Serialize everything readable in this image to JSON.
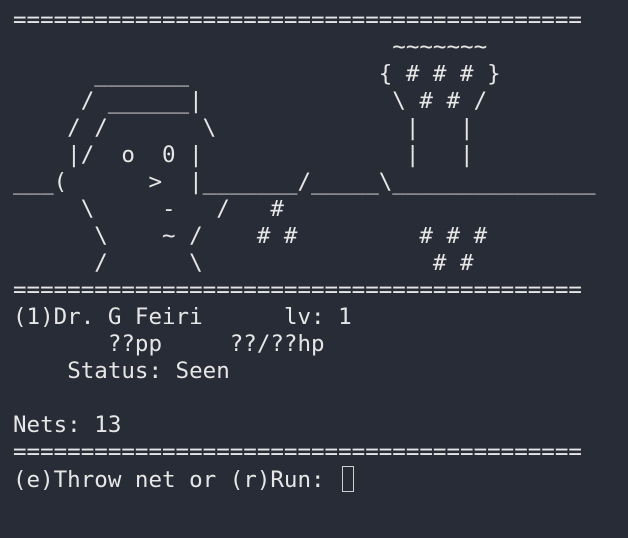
{
  "terminal": {
    "separator_top": "==========================================",
    "art_lines": [
      "                            ~~~~~~~",
      "      _______              { # # # }",
      "     / ______|              \\ # # /",
      "    / /       \\              |   |",
      "    |/  o  0 |               |   |",
      "___(      >  |_______/_____\\_______________",
      "     \\     -   /   #",
      "      \\    ~ /    # #         # # #",
      "      /      \\                 # #"
    ],
    "separator_mid": "==========================================",
    "creature": {
      "index": "(1)",
      "name": "Dr. G Feiri",
      "level": "lv: 1",
      "pp": "??pp",
      "hp": "??/??hp",
      "status": "Status: Seen"
    },
    "nets": "Nets: 13",
    "separator_bottom": "==========================================",
    "prompt": {
      "key_throw": "(e)",
      "throw_label": "Throw net",
      "or": " or ",
      "key_run": "(r)",
      "run_label": "Run: "
    },
    "input_value": ""
  }
}
